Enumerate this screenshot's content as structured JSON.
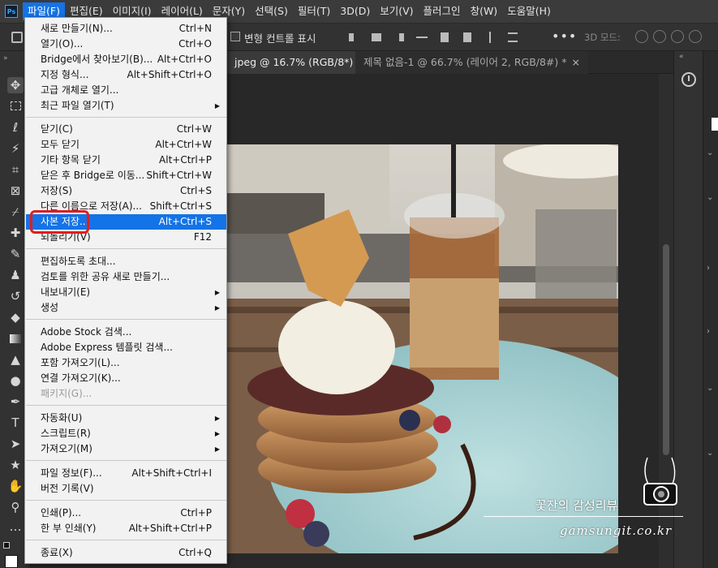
{
  "app": {
    "logo": "Ps"
  },
  "menubar": {
    "items": [
      {
        "label": "파일(F)"
      },
      {
        "label": "편집(E)"
      },
      {
        "label": "이미지(I)"
      },
      {
        "label": "레이어(L)"
      },
      {
        "label": "문자(Y)"
      },
      {
        "label": "선택(S)"
      },
      {
        "label": "필터(T)"
      },
      {
        "label": "3D(D)"
      },
      {
        "label": "보기(V)"
      },
      {
        "label": "플러그인"
      },
      {
        "label": "창(W)"
      },
      {
        "label": "도움말(H)"
      }
    ]
  },
  "options": {
    "transform_controls_label": "변형 컨트롤 표시",
    "more": "•••",
    "mode_3d_label": "3D 모드:"
  },
  "tabs": [
    {
      "label": "jpeg @ 16.7% (RGB/8*) *",
      "close": "×"
    },
    {
      "label": "제목 없음-1 @ 66.7% (레이어 2, RGB/8#) *",
      "close": "×"
    }
  ],
  "file_menu": {
    "items": [
      {
        "label": "새로 만들기(N)...",
        "shortcut": "Ctrl+N"
      },
      {
        "label": "열기(O)...",
        "shortcut": "Ctrl+O"
      },
      {
        "label": "Bridge에서 찾아보기(B)...",
        "shortcut": "Alt+Ctrl+O"
      },
      {
        "label": "지정 형식...",
        "shortcut": "Alt+Shift+Ctrl+O"
      },
      {
        "label": "고급 개체로 열기...",
        "shortcut": ""
      },
      {
        "label": "최근 파일 열기(T)",
        "shortcut": "",
        "submenu": true
      },
      {
        "label": "닫기(C)",
        "shortcut": "Ctrl+W"
      },
      {
        "label": "모두 닫기",
        "shortcut": "Alt+Ctrl+W"
      },
      {
        "label": "기타 항목 닫기",
        "shortcut": "Alt+Ctrl+P"
      },
      {
        "label": "닫은 후 Bridge로 이동...",
        "shortcut": "Shift+Ctrl+W"
      },
      {
        "label": "저장(S)",
        "shortcut": "Ctrl+S"
      },
      {
        "label": "다른 이름으로 저장(A)...",
        "shortcut": "Shift+Ctrl+S"
      },
      {
        "label": "사본 저장...",
        "shortcut": "Alt+Ctrl+S",
        "highlighted": true
      },
      {
        "label": "되돌리기(V)",
        "shortcut": "F12"
      },
      {
        "label": "편집하도록 초대...",
        "shortcut": ""
      },
      {
        "label": "검토를 위한 공유 새로 만들기...",
        "shortcut": ""
      },
      {
        "label": "내보내기(E)",
        "shortcut": "",
        "submenu": true
      },
      {
        "label": "생성",
        "shortcut": "",
        "submenu": true
      },
      {
        "label": "Adobe Stock 검색...",
        "shortcut": ""
      },
      {
        "label": "Adobe Express 템플릿 검색...",
        "shortcut": ""
      },
      {
        "label": "포함 가져오기(L)...",
        "shortcut": ""
      },
      {
        "label": "연결 가져오기(K)...",
        "shortcut": ""
      },
      {
        "label": "패키지(G)...",
        "shortcut": "",
        "disabled": true
      },
      {
        "label": "자동화(U)",
        "shortcut": "",
        "submenu": true
      },
      {
        "label": "스크립트(R)",
        "shortcut": "",
        "submenu": true
      },
      {
        "label": "가져오기(M)",
        "shortcut": "",
        "submenu": true
      },
      {
        "label": "파일 정보(F)...",
        "shortcut": "Alt+Shift+Ctrl+I"
      },
      {
        "label": "버전 기록(V)",
        "shortcut": ""
      },
      {
        "label": "인쇄(P)...",
        "shortcut": "Ctrl+P"
      },
      {
        "label": "한 부 인쇄(Y)",
        "shortcut": "Alt+Shift+Ctrl+P"
      },
      {
        "label": "종료(X)",
        "shortcut": "Ctrl+Q"
      }
    ]
  },
  "watermark": {
    "title": "꽃잔의 감성리뷰",
    "url": "gamsungit.co.kr"
  },
  "colors": {
    "accent": "#1473e6",
    "highlight_box": "#e01e1e"
  }
}
